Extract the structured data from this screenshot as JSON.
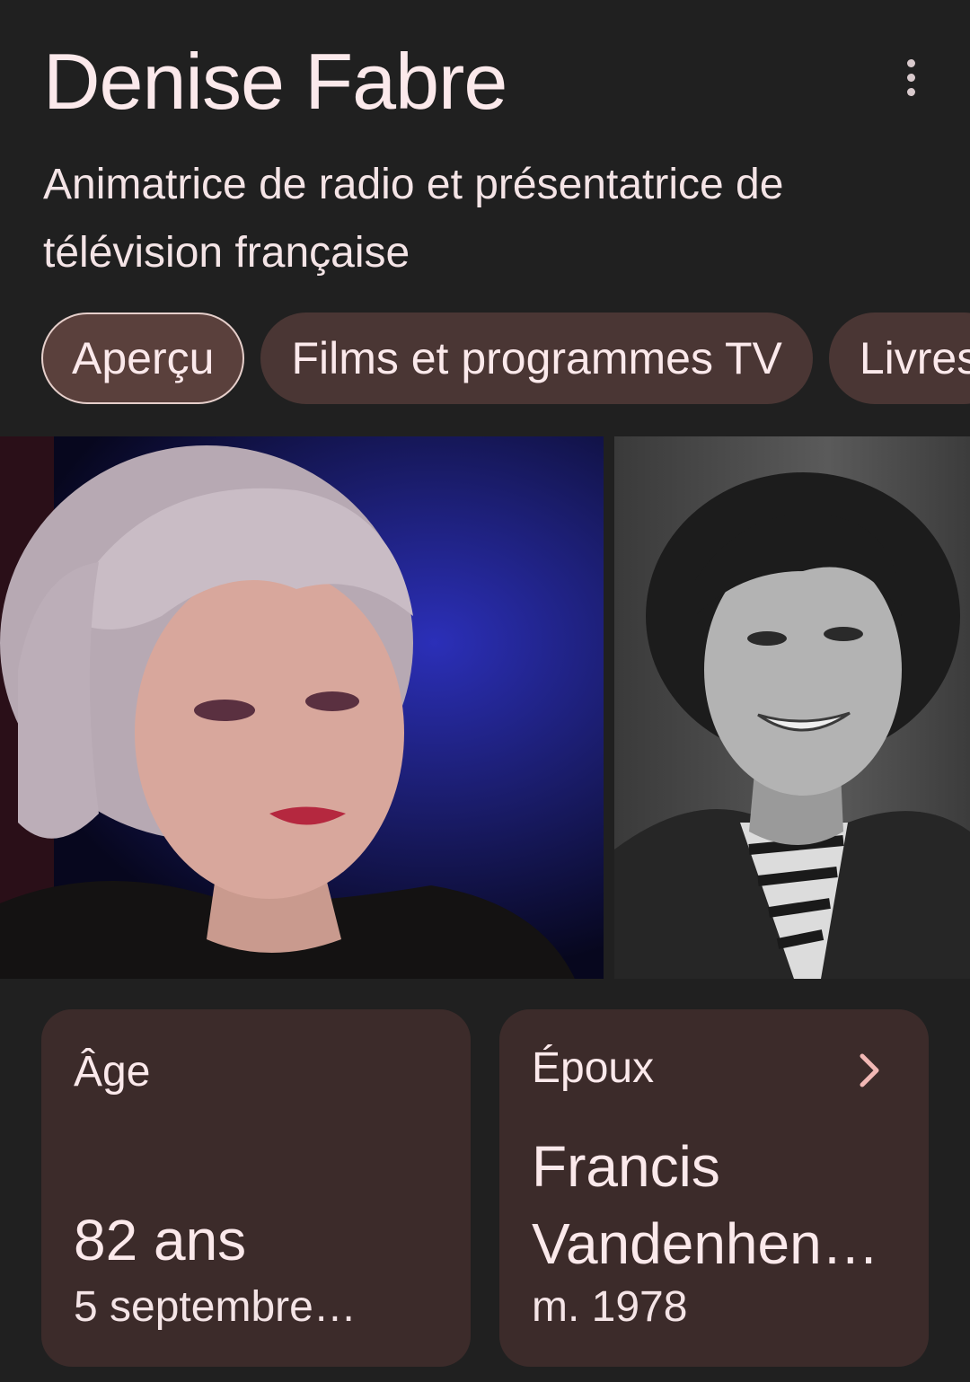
{
  "header": {
    "title": "Denise Fabre",
    "subtitle": "Animatrice de radio et présentatrice de télévision française",
    "more_icon": "more-vert-icon"
  },
  "tabs": [
    {
      "label": "Aperçu",
      "active": true
    },
    {
      "label": "Films et programmes TV",
      "active": false
    },
    {
      "label": "Livres",
      "active": false
    }
  ],
  "images": [
    {
      "description": "color-photo"
    },
    {
      "description": "bw-photo"
    }
  ],
  "cards": {
    "age": {
      "label": "Âge",
      "value": "82 ans",
      "sub": "5 septembre…"
    },
    "spouse": {
      "label": "Époux",
      "name": "Francis Vandenhen…",
      "sub": "m. 1978",
      "icon": "chevron-right-icon"
    }
  },
  "colors": {
    "background": "#202020",
    "chip": "#4a3634",
    "card": "#3c2b2a",
    "text": "#fbe9eb",
    "accent": "#f2b8b5"
  }
}
